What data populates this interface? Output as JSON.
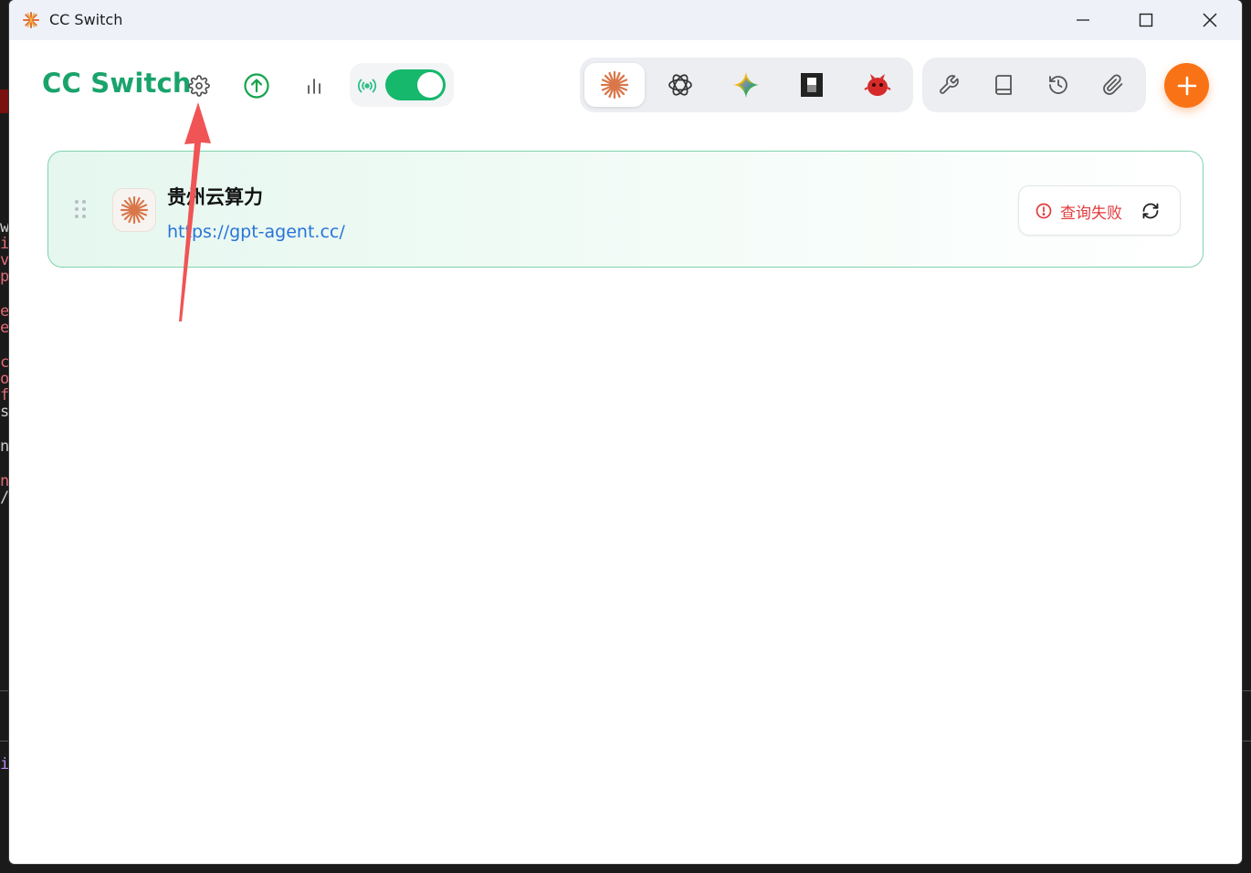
{
  "window": {
    "title": "CC Switch"
  },
  "header": {
    "brand": "CC Switch",
    "icons": [
      "gear-icon",
      "upload-circle-icon",
      "bar-chart-icon",
      "broadcast-icon"
    ],
    "proxy_toggle_on": true
  },
  "app_switcher": {
    "apps": [
      {
        "icon": "claude-icon",
        "active": true
      },
      {
        "icon": "openai-icon",
        "active": false
      },
      {
        "icon": "gemini-icon",
        "active": false
      },
      {
        "icon": "dark-block-icon",
        "active": false
      },
      {
        "icon": "red-mascot-icon",
        "active": false
      }
    ]
  },
  "toolbar": {
    "tools": [
      "wrench-icon",
      "book-icon",
      "history-icon",
      "paperclip-icon"
    ],
    "add_icon": "plus-icon"
  },
  "providers": [
    {
      "name": "贵州云算力",
      "url": "https://gpt-agent.cc/",
      "status": "查询失败",
      "icon": "claude-icon"
    }
  ],
  "colors": {
    "brand": "#1aa36b",
    "toggle": "#16b86c",
    "add_button": "#f97316",
    "error": "#e03b3b",
    "link": "#2874d8",
    "annotation_arrow": "#f05454"
  }
}
